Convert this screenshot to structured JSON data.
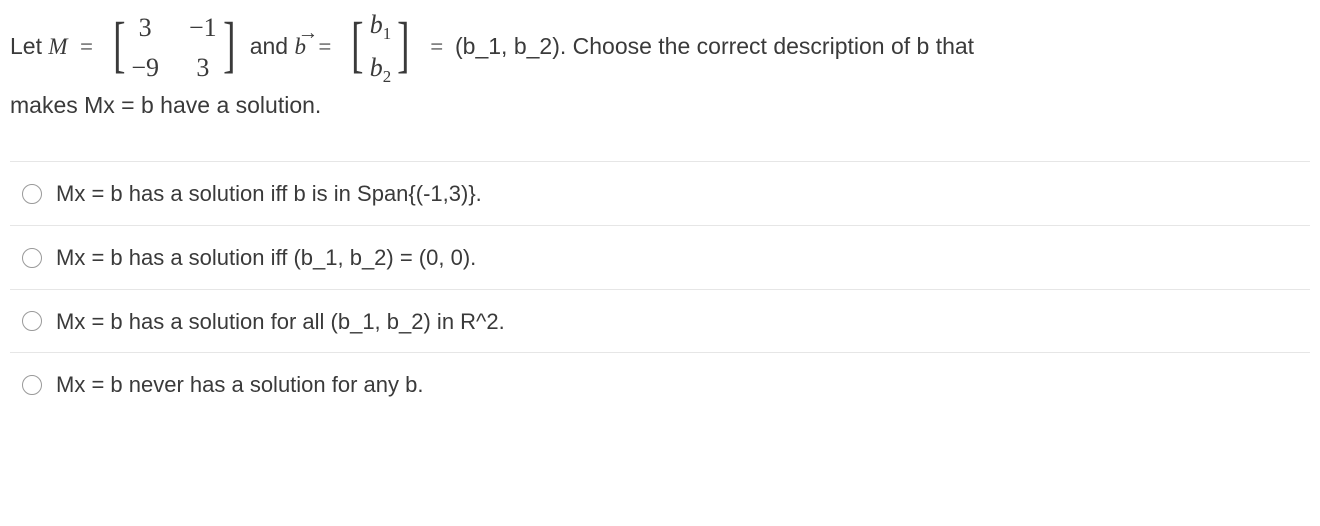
{
  "question": {
    "let_label": "Let ",
    "M_label": "M",
    "eq1": " = ",
    "matrix_M": {
      "r11": "3",
      "r12": "−1",
      "r21": "−9",
      "r22": "3"
    },
    "and_label": " and ",
    "b_label": "b",
    "eq2": " = ",
    "vector_b": {
      "r1_a": "b",
      "r1_sub": "1",
      "r2_a": "b",
      "r2_sub": "2"
    },
    "eq3": " = ",
    "rhs_label": "(b_1, b_2). Choose the correct description of b that",
    "line2": "makes Mx = b have a solution."
  },
  "options": [
    {
      "text": "Mx = b has a solution iff b is in Span{(-1,3)}."
    },
    {
      "text": "Mx = b has a solution iff (b_1, b_2) = (0, 0)."
    },
    {
      "text": "Mx = b has a solution for all (b_1, b_2) in R^2."
    },
    {
      "text": "Mx = b never has a solution for any b."
    }
  ]
}
